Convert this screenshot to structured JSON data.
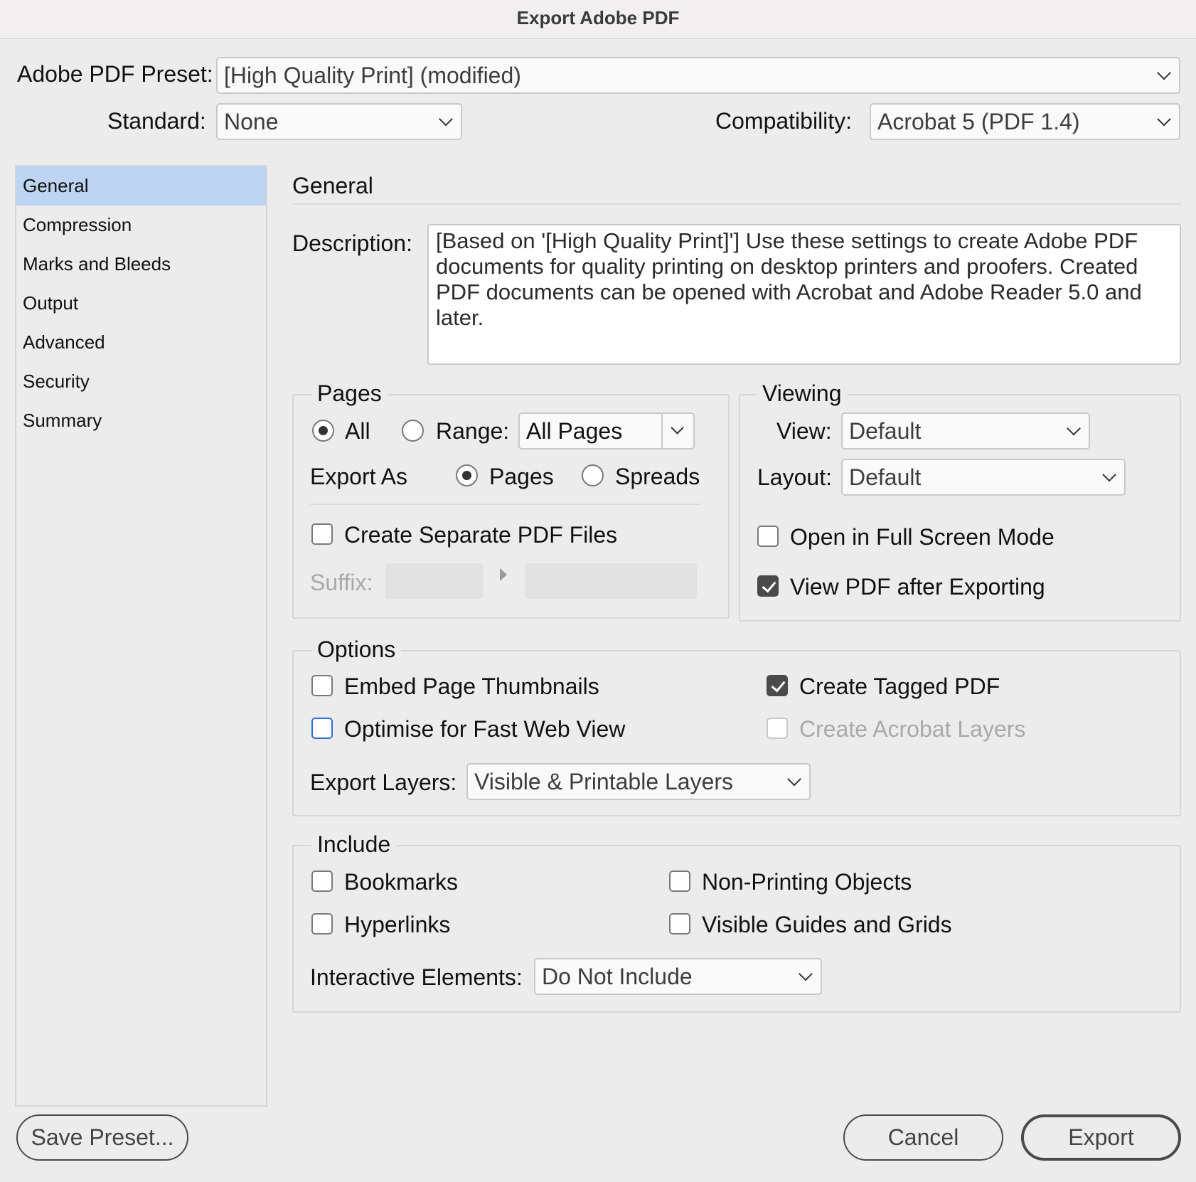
{
  "window": {
    "title": "Export Adobe PDF"
  },
  "preset": {
    "label": "Adobe PDF Preset:",
    "value": "[High Quality Print] (modified)"
  },
  "standard": {
    "label": "Standard:",
    "value": "None"
  },
  "compatibility": {
    "label": "Compatibility:",
    "value": "Acrobat 5 (PDF 1.4)"
  },
  "sidebar": {
    "items": [
      {
        "label": "General",
        "selected": true
      },
      {
        "label": "Compression"
      },
      {
        "label": "Marks and Bleeds"
      },
      {
        "label": "Output"
      },
      {
        "label": "Advanced"
      },
      {
        "label": "Security"
      },
      {
        "label": "Summary"
      }
    ]
  },
  "panel": {
    "title": "General",
    "description_label": "Description:",
    "description": "[Based on '[High Quality Print]'] Use these settings to create Adobe PDF documents for quality printing on desktop printers and proofers. Created PDF documents can be opened with Acrobat and Adobe Reader 5.0 and later."
  },
  "pages": {
    "legend": "Pages",
    "all_label": "All",
    "all_selected": true,
    "range_label": "Range:",
    "range_value": "All Pages",
    "export_as_label": "Export As",
    "pages_label": "Pages",
    "pages_selected": true,
    "spreads_label": "Spreads",
    "separate_files_label": "Create Separate PDF Files",
    "separate_files_checked": false,
    "suffix_label": "Suffix:"
  },
  "viewing": {
    "legend": "Viewing",
    "view_label": "View:",
    "view_value": "Default",
    "layout_label": "Layout:",
    "layout_value": "Default",
    "full_screen_label": "Open in Full Screen Mode",
    "full_screen_checked": false,
    "view_after_label": "View PDF after Exporting",
    "view_after_checked": true
  },
  "options": {
    "legend": "Options",
    "embed_thumbnails_label": "Embed Page Thumbnails",
    "embed_thumbnails_checked": false,
    "fast_web_label": "Optimise for Fast Web View",
    "fast_web_checked": false,
    "tagged_pdf_label": "Create Tagged PDF",
    "tagged_pdf_checked": true,
    "acrobat_layers_label": "Create Acrobat Layers",
    "acrobat_layers_enabled": false,
    "export_layers_label": "Export Layers:",
    "export_layers_value": "Visible & Printable Layers"
  },
  "include": {
    "legend": "Include",
    "bookmarks_label": "Bookmarks",
    "hyperlinks_label": "Hyperlinks",
    "non_printing_label": "Non-Printing Objects",
    "guides_grids_label": "Visible Guides and Grids",
    "interactive_label": "Interactive Elements:",
    "interactive_value": "Do Not Include"
  },
  "buttons": {
    "save_preset": "Save Preset...",
    "cancel": "Cancel",
    "export": "Export"
  },
  "colors": {
    "selected_sidebar": "#bdd5f2",
    "focus_ring": "#2f6fd0",
    "background": "#ececec"
  }
}
